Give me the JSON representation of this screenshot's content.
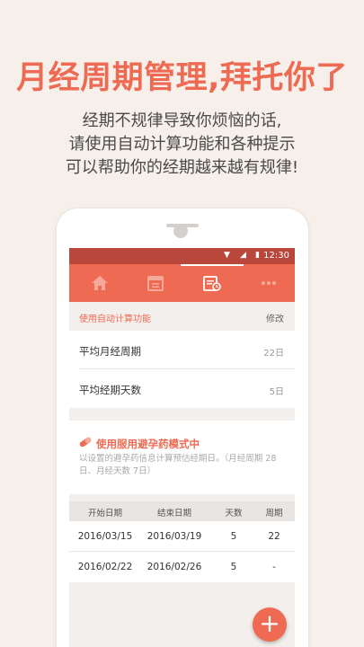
{
  "headline": "月经周期管理,拜托你了",
  "subtitle_lines": [
    "经期不规律导致你烦恼的话,",
    "请使用自动计算功能和各种提示",
    "可以帮助你的经期越来越有规律!"
  ],
  "status_bar": {
    "time": "12:30"
  },
  "tabs": [
    "home-icon",
    "calendar-icon",
    "records-icon",
    "more-icon"
  ],
  "auto_calc": {
    "section_label": "使用自动计算功能",
    "edit_label": "修改",
    "rows": [
      {
        "label": "平均月经周期",
        "value": "22日"
      },
      {
        "label": "平均经期天数",
        "value": "5日"
      }
    ]
  },
  "pill_mode": {
    "title": "使用服用避孕药模式中",
    "description": "以设置的避孕药信息计算预估经期日。（月经周期 28日、月经天数 7日）"
  },
  "table": {
    "headers": [
      "开始日期",
      "结束日期",
      "天数",
      "周期"
    ],
    "rows": [
      [
        "2016/03/15",
        "2016/03/19",
        "5",
        "22"
      ],
      [
        "2016/02/22",
        "2016/02/26",
        "5",
        "-"
      ]
    ]
  },
  "fab_label": "+",
  "colors": {
    "accent": "#ef6a52",
    "status_bar": "#b9473b",
    "background": "#f6efea"
  }
}
